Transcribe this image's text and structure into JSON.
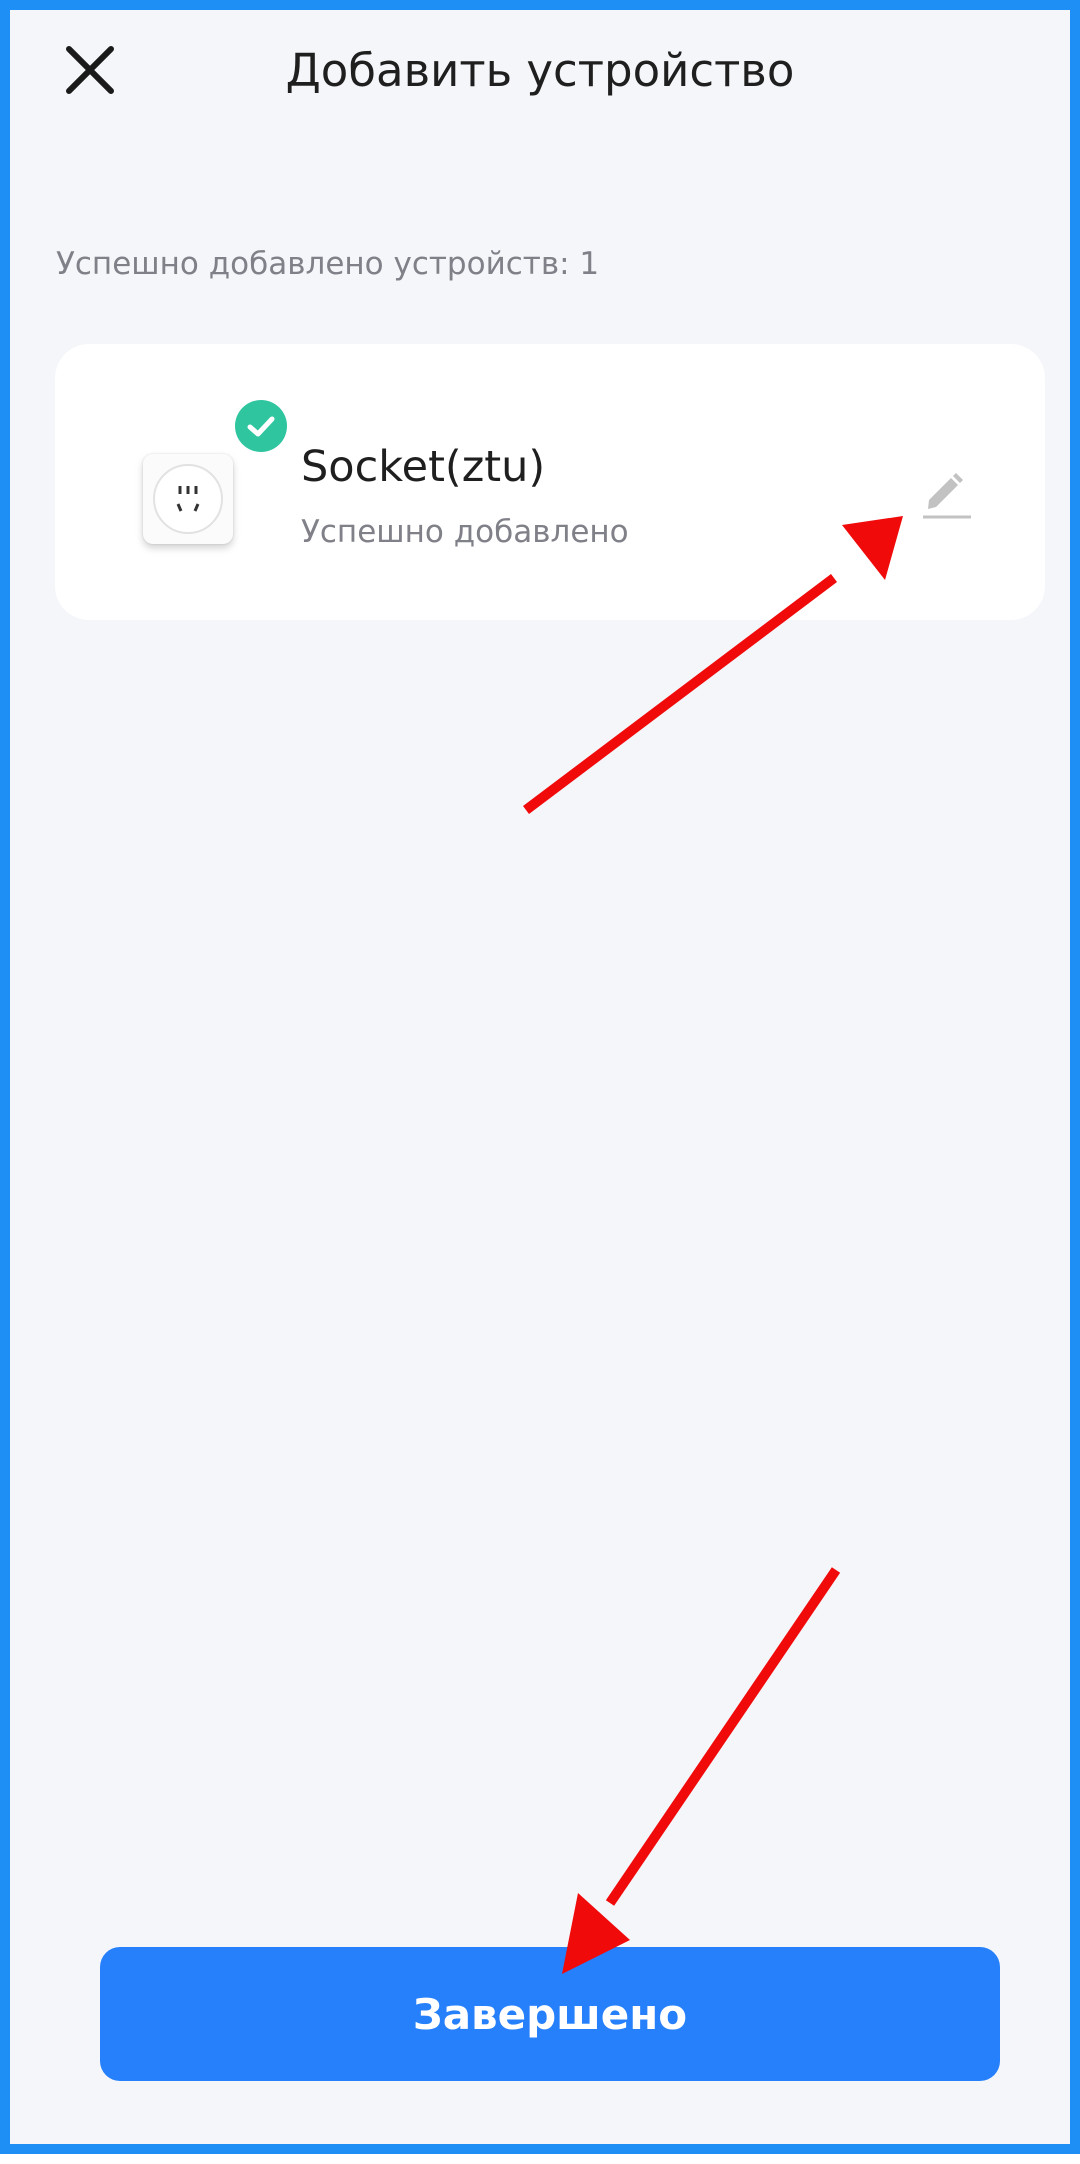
{
  "header": {
    "title": "Добавить устройство",
    "close_icon": "close-icon"
  },
  "summary": {
    "added_count_text": "Успешно добавлено устройств: 1"
  },
  "device": {
    "name": "Socket(ztu)",
    "status": "Успешно добавлено",
    "image_icon": "socket-icon",
    "badge_icon": "check-icon",
    "edit_icon": "pencil-icon"
  },
  "footer": {
    "done_label": "Завершено"
  },
  "colors": {
    "frame_border": "#1E90F5",
    "background": "#F5F6FA",
    "primary_button": "#2680FB",
    "success_badge": "#2FC59F",
    "annotation_arrow": "#F00A0A"
  }
}
